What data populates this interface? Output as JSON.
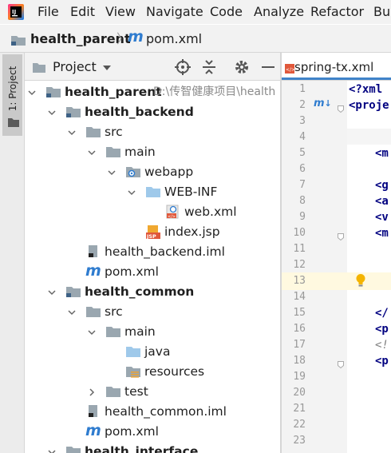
{
  "menubar": {
    "items": [
      "File",
      "Edit",
      "View",
      "Navigate",
      "Code",
      "Analyze",
      "Refactor",
      "Bui"
    ]
  },
  "breadcrumb": {
    "project": "health_parent",
    "file": "pom.xml",
    "file_icon": "maven-icon"
  },
  "sidebar": {
    "tab_label": "1: Project"
  },
  "project_panel": {
    "title": "Project",
    "tree": [
      {
        "label": "health_parent",
        "path": "D:\\传智健康项目\\health",
        "bold": true,
        "icon": "module-folder-icon",
        "expanded": true
      },
      {
        "label": "health_backend",
        "bold": true,
        "icon": "module-folder-icon",
        "expanded": true
      },
      {
        "label": "src",
        "icon": "folder-icon",
        "expanded": true
      },
      {
        "label": "main",
        "icon": "folder-icon",
        "expanded": true
      },
      {
        "label": "webapp",
        "icon": "web-folder-icon",
        "expanded": true
      },
      {
        "label": "WEB-INF",
        "icon": "folder-icon",
        "expanded": true
      },
      {
        "label": "web.xml",
        "icon": "web-xml-icon"
      },
      {
        "label": "index.jsp",
        "icon": "jsp-file-icon"
      },
      {
        "label": "health_backend.iml",
        "icon": "iml-file-icon"
      },
      {
        "label": "pom.xml",
        "icon": "maven-icon"
      },
      {
        "label": "health_common",
        "bold": true,
        "icon": "module-folder-icon",
        "expanded": true
      },
      {
        "label": "src",
        "icon": "folder-icon",
        "expanded": true
      },
      {
        "label": "main",
        "icon": "folder-icon",
        "expanded": true
      },
      {
        "label": "java",
        "icon": "source-folder-icon"
      },
      {
        "label": "resources",
        "icon": "resources-folder-icon"
      },
      {
        "label": "test",
        "icon": "folder-icon",
        "expanded": false
      },
      {
        "label": "health_common.iml",
        "icon": "iml-file-icon"
      },
      {
        "label": "pom.xml",
        "icon": "maven-icon"
      },
      {
        "label": "health_interface",
        "bold": true,
        "icon": "module-folder-icon",
        "expanded": true
      }
    ]
  },
  "editor": {
    "tab_label": "spring-tx.xml",
    "current_line": "13",
    "line_numbers": [
      "1",
      "2",
      "3",
      "4",
      "5",
      "6",
      "7",
      "8",
      "9",
      "10",
      "11",
      "12",
      "13",
      "14",
      "15",
      "16",
      "17",
      "18",
      "19",
      "20",
      "21",
      "22",
      "23"
    ],
    "code_lines": [
      {
        "line": "1",
        "text": "<?xml"
      },
      {
        "line": "2",
        "text": "<proje"
      },
      {
        "line": "5",
        "text": "<m"
      },
      {
        "line": "7",
        "text": "<g"
      },
      {
        "line": "8",
        "text": "<a"
      },
      {
        "line": "9",
        "text": "<v"
      },
      {
        "line": "10",
        "text": "<m"
      },
      {
        "line": "15",
        "text": "</"
      },
      {
        "line": "16",
        "text": "<p"
      },
      {
        "line": "17",
        "text": "<!"
      },
      {
        "line": "18",
        "text": "<p"
      }
    ]
  },
  "colors": {
    "chrome_bg": "#f2f2f2",
    "folder_blue": "#9fc9ea",
    "maven_blue": "#2f7ccf",
    "current_line_bg": "#fff9e0",
    "tag_color": "#000080"
  }
}
